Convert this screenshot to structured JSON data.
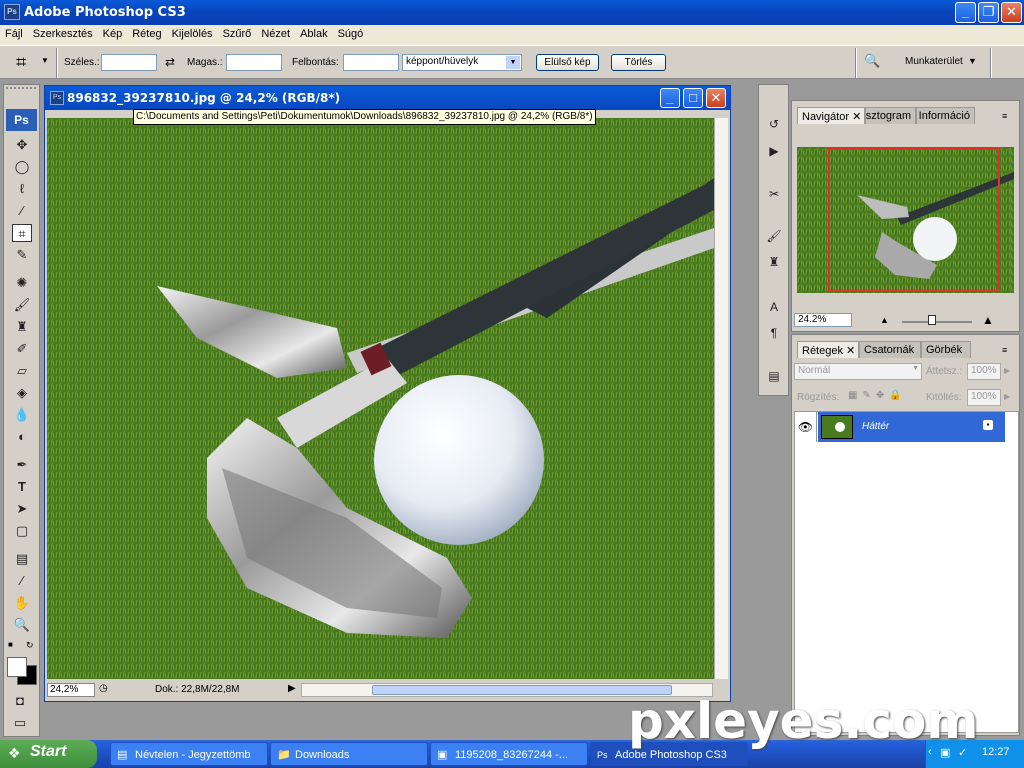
{
  "app": {
    "title": "Adobe Photoshop CS3",
    "icon_label": "Ps"
  },
  "menu": [
    "Fájl",
    "Szerkesztés",
    "Kép",
    "Réteg",
    "Kijelölés",
    "Szűrő",
    "Nézet",
    "Ablak",
    "Súgó"
  ],
  "options": {
    "width_label": "Széles.:",
    "height_label": "Magas.:",
    "resolution_label": "Felbontás:",
    "unit_value": "képpont/hüvelyk",
    "front_image_button": "Elülső kép",
    "clear_button": "Törlés",
    "workspace_label": "Munkaterület"
  },
  "toolbox": {
    "logo": "Ps"
  },
  "document": {
    "title": "896832_39237810.jpg @ 24,2% (RGB/8*)",
    "tooltip": "C:\\Documents and Settings\\Peti\\Dokumentumok\\Downloads\\896832_39237810.jpg @ 24,2% (RGB/8*)",
    "zoom": "24,2%",
    "doc_size": "Dok.: 22,8M/22,8M"
  },
  "navigator": {
    "tabs": [
      "Navigátor",
      "Hisztogram",
      "Információ"
    ],
    "zoom": "24.2%"
  },
  "layers": {
    "tabs": [
      "Rétegek",
      "Csatornák",
      "Görbék"
    ],
    "blend_mode": "Normál",
    "opacity_label": "Áttetsz.:",
    "opacity_value": "100%",
    "lock_label": "Rögzítés:",
    "fill_label": "Kitöltés:",
    "fill_value": "100%",
    "layer_name": "Háttér"
  },
  "taskbar": {
    "start": "Start",
    "tasks": [
      "Névtelen - Jegyzettömb",
      "Downloads",
      "1195208_83267244 -...",
      "Adobe Photoshop CS3"
    ],
    "time": "12:27"
  },
  "watermark": "pxleyes.com",
  "colors": {
    "xp_blue": "#0847c0",
    "layer_selected": "#3168d5",
    "nav_view_box": "#e0302a"
  }
}
